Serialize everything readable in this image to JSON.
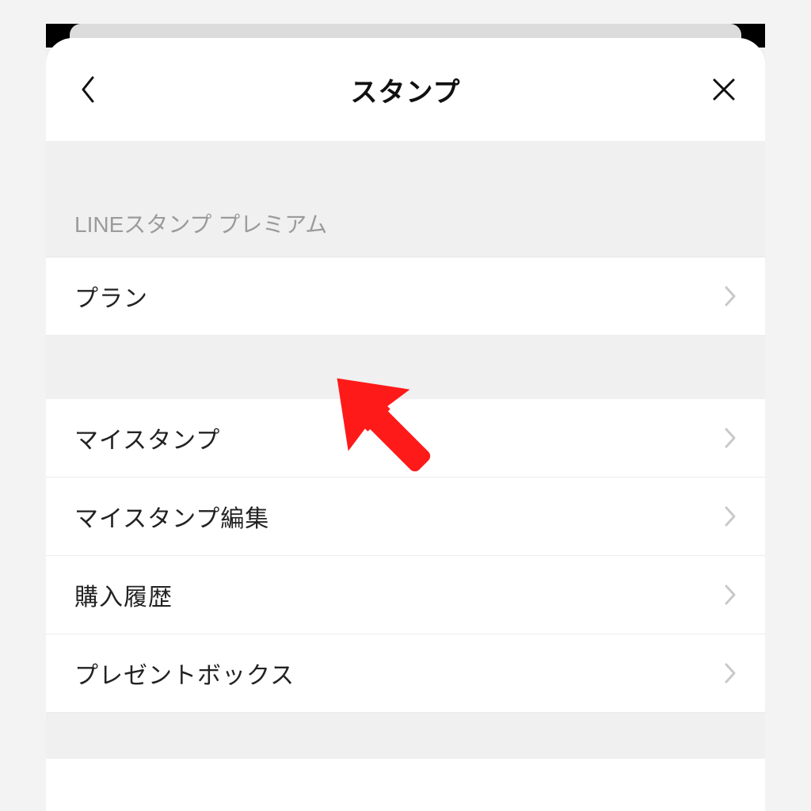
{
  "header": {
    "title": "スタンプ"
  },
  "sections": {
    "premium": {
      "header": "LINEスタンプ プレミアム",
      "items": [
        {
          "label": "プラン"
        }
      ]
    },
    "main": {
      "items": [
        {
          "label": "マイスタンプ"
        },
        {
          "label": "マイスタンプ編集"
        },
        {
          "label": "購入履歴"
        },
        {
          "label": "プレゼントボックス"
        }
      ]
    }
  },
  "colors": {
    "annotation_arrow": "#ff1a1a"
  }
}
